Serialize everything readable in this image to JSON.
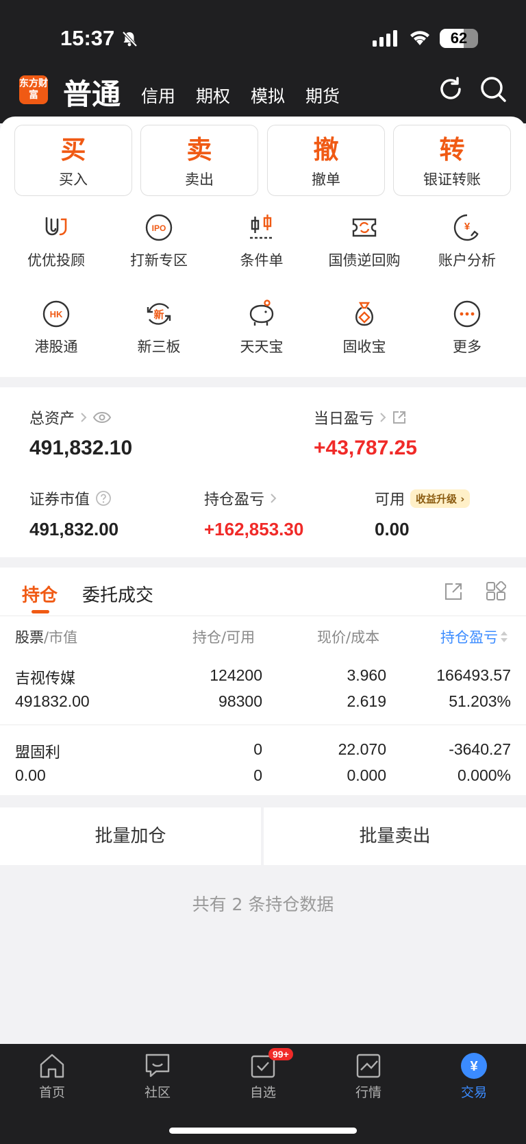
{
  "status_bar": {
    "time": "15:37",
    "battery": "62",
    "battery_level": 0.62
  },
  "header": {
    "logo_text": "东方财富",
    "account_type": "普通",
    "tabs": [
      "信用",
      "期权",
      "模拟",
      "期货"
    ]
  },
  "trade_buttons": [
    {
      "char": "买",
      "label": "买入"
    },
    {
      "char": "卖",
      "label": "卖出"
    },
    {
      "char": "撤",
      "label": "撤单"
    },
    {
      "char": "转",
      "label": "银证转账"
    }
  ],
  "quick_menu": [
    {
      "label": "优优投顾",
      "icon": "uu-advisor-icon"
    },
    {
      "label": "打新专区",
      "icon": "ipo-icon",
      "icon_text": "IPO"
    },
    {
      "label": "条件单",
      "icon": "condition-order-icon"
    },
    {
      "label": "国债逆回购",
      "icon": "reverse-repo-icon"
    },
    {
      "label": "账户分析",
      "icon": "account-analysis-icon",
      "icon_text": "¥"
    },
    {
      "label": "港股通",
      "icon": "hk-connect-icon",
      "icon_text": "HK"
    },
    {
      "label": "新三板",
      "icon": "neeq-icon",
      "icon_text": "新"
    },
    {
      "label": "天天宝",
      "icon": "piggy-bank-icon"
    },
    {
      "label": "固收宝",
      "icon": "money-bag-icon"
    },
    {
      "label": "更多",
      "icon": "more-icon"
    }
  ],
  "assets": {
    "total_label": "总资产",
    "total_value": "491,832.10",
    "daily_pl_label": "当日盈亏",
    "daily_pl_value": "+43,787.25",
    "market_value_label": "证券市值",
    "market_value": "491,832.00",
    "holding_pl_label": "持仓盈亏",
    "holding_pl_value": "+162,853.30",
    "available_label": "可用",
    "available_badge": "收益升级",
    "available_value": "0.00"
  },
  "positions": {
    "tabs": [
      "持仓",
      "委托成交"
    ],
    "headers": {
      "col1_a": "股票",
      "col1_b": "/市值",
      "col2": "持仓/可用",
      "col3": "现价/成本",
      "col4": "持仓盈亏"
    },
    "rows": [
      {
        "name": "吉视传媒",
        "market_value": "491832.00",
        "holding": "124200",
        "available": "98300",
        "price": "3.960",
        "cost": "2.619",
        "pl": "166493.57",
        "pl_pct": "51.203%",
        "dir": "up"
      },
      {
        "name": "盟固利",
        "market_value": "0.00",
        "holding": "0",
        "available": "0",
        "price": "22.070",
        "cost": "0.000",
        "pl": "-3640.27",
        "pl_pct": "0.000%",
        "dir": "down"
      }
    ],
    "batch_add": "批量加仓",
    "batch_sell": "批量卖出",
    "summary": "共有 2 条持仓数据"
  },
  "bottom_nav": [
    {
      "label": "首页",
      "icon": "home-icon"
    },
    {
      "label": "社区",
      "icon": "community-icon"
    },
    {
      "label": "自选",
      "icon": "watchlist-icon",
      "badge": "99+"
    },
    {
      "label": "行情",
      "icon": "market-icon"
    },
    {
      "label": "交易",
      "icon": "trade-icon",
      "icon_text": "¥",
      "active": true
    }
  ],
  "colors": {
    "accent": "#f05a14",
    "up": "#f02a28",
    "down": "#1aa22c",
    "active_nav": "#3b8bff"
  }
}
